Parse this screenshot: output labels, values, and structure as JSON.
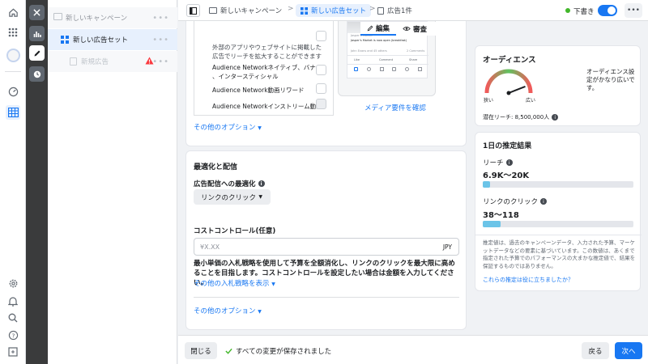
{
  "tree": {
    "campaign": "新しいキャンペーン",
    "adset": "新しい広告セット",
    "ad": "新規広告"
  },
  "topbar": {
    "crumb_campaign": "新しいキャンペーン",
    "crumb_adset": "新しい広告セット",
    "crumb_ad": "広告1件",
    "draft_label": "下書き",
    "tab_edit": "編集",
    "tab_review": "審査"
  },
  "placements": {
    "desc_top": "外部のアプリやウェブサイトに掲載した",
    "desc_bottom": "広告でリーチを拡大することができます",
    "native_line1": "Audience Networkネイティブ、バナー",
    "native_line2": "、インタースティシャル",
    "rewarded": "Audience Network動画リワード",
    "instream": "Audience Networkインストリーム動画",
    "more_options": "その他のオプション",
    "media_link": "メディア要件を確認",
    "preview_brand": "Jasper's Market",
    "preview_caption": "Jasper's Market is now open (breakfast)",
    "preview_like": "Like",
    "preview_comment": "Comment",
    "preview_share": "Share",
    "preview_meta": "John Evans and 45 others",
    "preview_comments": "2 Comments"
  },
  "optimization": {
    "section_title": "最適化と配信",
    "label": "広告配信への最適化",
    "dropdown_value": "リンクのクリック",
    "cost_label": "コストコントロール(任意)",
    "cost_placeholder": "¥X.XX",
    "currency": "JPY",
    "description": "最小単価の入札戦略を使用して予算を全額消化し、リンクのクリックを最大限に高めることを目指します。コストコントロールを設定したい場合は金額を入力してください。",
    "bid_link": "その他の入札戦略を表示",
    "more_options": "その他のオプション"
  },
  "audience": {
    "title": "オーディエンス",
    "description": "オーディエンス設定がかなり広いです。",
    "narrow": "狭い",
    "broad": "広い",
    "potential_reach": "潜在リーチ: 8,500,000人",
    "gauge_level": 0.88
  },
  "estimates": {
    "title": "1日の推定結果",
    "reach_label": "リーチ",
    "reach_value": "6.9K〜20K",
    "reach_fill": 0.05,
    "clicks_label": "リンクのクリック",
    "clicks_value": "38〜118",
    "clicks_fill": 0.12,
    "disclaimer": "推定値は、過去のキャンペーンデータ、入力された予算、マーケットデータなどの要素に基づいています。この数値は、あくまで指定された予算でのパフォーマンスの大まかな推定値で、結果を保証するものではありません。",
    "feedback_link": "これらの推定は役に立ちましたか？"
  },
  "footer": {
    "close": "閉じる",
    "saved": "すべての変更が保存されました",
    "back": "戻る",
    "next": "次へ"
  },
  "colors": {
    "accent": "#1877f2",
    "warning": "#fa383e",
    "saved": "#42b72a"
  }
}
